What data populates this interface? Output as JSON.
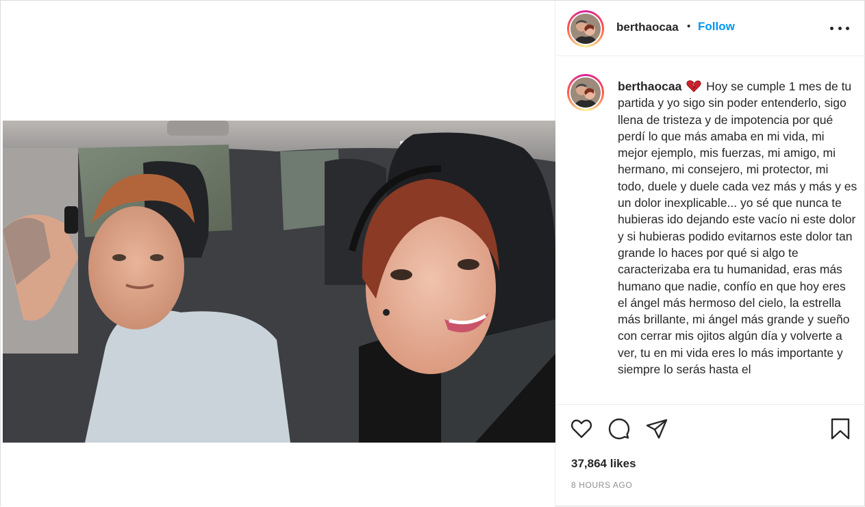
{
  "post": {
    "username": "berthaocaa",
    "separator": "•",
    "follow_label": "Follow",
    "more_icon": "more-horizontal-icon"
  },
  "caption": {
    "username": "berthaocaa",
    "emoji": "broken-heart-emoji",
    "text": "Hoy se cumple 1 mes de tu partida y yo sigo sin poder entenderlo, sigo llena de tristeza y de impotencia por qué perdí lo que más amaba en mi vida, mi mejor ejemplo, mis fuerzas, mi amigo, mi hermano, mi consejero, mi protector, mi todo, duele y duele cada vez más y más y es un dolor inexplicable... yo sé que nunca te hubieras ido dejando este vacío ni este dolor y si hubieras podido evitarnos este dolor tan grande lo haces por qué si algo te caracterizaba era tu humanidad, eras más humano que nadie, confío en que hoy eres el ángel más hermoso del cielo, la estrella más brillante, mi ángel más grande y sueño con cerrar mis ojitos algún día y volverte a ver, tu en mi vida eres lo más importante y siempre lo serás hasta el"
  },
  "actions": {
    "like_icon": "heart-icon",
    "comment_icon": "comment-icon",
    "share_icon": "share-icon",
    "save_icon": "bookmark-icon"
  },
  "likes": "37,864 likes",
  "timestamp": "8 HOURS AGO",
  "colors": {
    "follow": "#0095f6",
    "text": "#262626",
    "muted": "#8e8e8e",
    "divider": "#efefef"
  }
}
